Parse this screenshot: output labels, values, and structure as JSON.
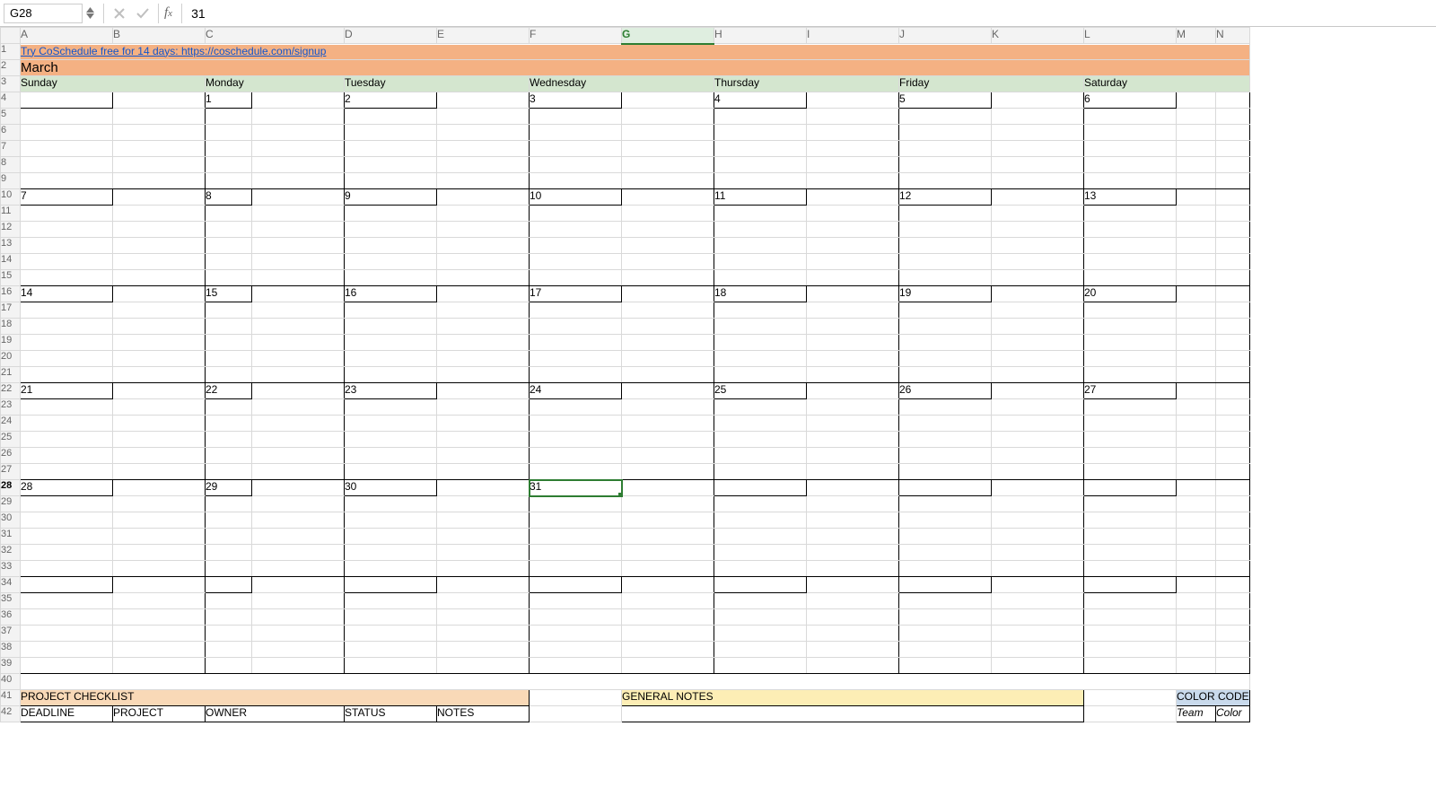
{
  "formulaBar": {
    "nameBox": "G28",
    "formulaValue": "31"
  },
  "colHeaders": [
    "A",
    "B",
    "C",
    "D",
    "E",
    "F",
    "G",
    "H",
    "I",
    "J",
    "K",
    "L",
    "M",
    "N"
  ],
  "activeCol": "G",
  "rowHeaders": [
    1,
    2,
    3,
    4,
    5,
    6,
    7,
    8,
    9,
    10,
    11,
    12,
    13,
    14,
    15,
    16,
    17,
    18,
    19,
    20,
    21,
    22,
    23,
    24,
    25,
    26,
    27,
    28,
    29,
    30,
    31,
    32,
    33,
    34,
    35,
    36,
    37,
    38,
    39,
    40,
    41,
    42
  ],
  "activeRow": 28,
  "row1Link": "Try CoSchedule free for 14 days: https://coschedule.com/signup",
  "monthTitle": "March",
  "dayNames": [
    "Sunday",
    "Monday",
    "Tuesday",
    "Wednesday",
    "Thursday",
    "Friday",
    "Saturday"
  ],
  "calendar": {
    "week1": [
      "",
      "1",
      "2",
      "3",
      "4",
      "5",
      "6"
    ],
    "week2": [
      "7",
      "8",
      "9",
      "10",
      "11",
      "12",
      "13"
    ],
    "week3": [
      "14",
      "15",
      "16",
      "17",
      "18",
      "19",
      "20"
    ],
    "week4": [
      "21",
      "22",
      "23",
      "24",
      "25",
      "26",
      "27"
    ],
    "week5": [
      "28",
      "29",
      "30",
      "31",
      "",
      "",
      ""
    ],
    "week6": [
      "",
      "",
      "",
      "",
      "",
      "",
      ""
    ]
  },
  "panels": {
    "projectChecklist": {
      "title": "PROJECT CHECKLIST",
      "cols": [
        "DEADLINE",
        "PROJECT",
        "OWNER",
        "STATUS",
        "NOTES"
      ]
    },
    "generalNotes": {
      "title": "GENERAL NOTES"
    },
    "colorCode": {
      "title": "COLOR CODE",
      "cols": [
        "Team",
        "Color"
      ]
    }
  }
}
